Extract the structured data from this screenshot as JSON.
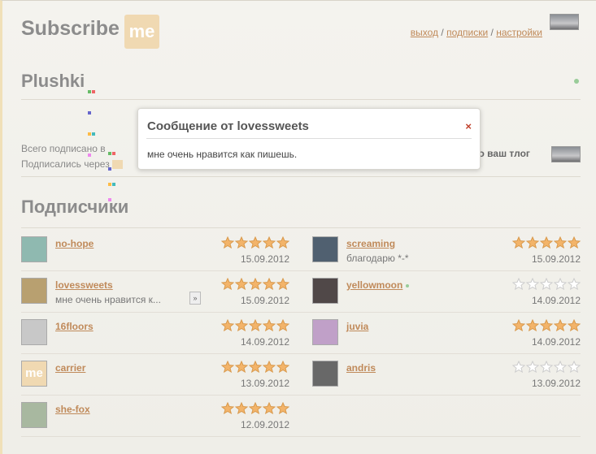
{
  "header": {
    "logo_text": "Subscribe",
    "logo_badge": "me",
    "links": {
      "exit": "выход",
      "subscriptions": "подписки",
      "settings": "настройки"
    },
    "separator": "/"
  },
  "blog": {
    "title": "Plushki",
    "stats_line1": "Всего подписано в",
    "stats_line2": "Подписались через",
    "tlog_text": "его ваш тлог"
  },
  "modal": {
    "title": "Сообщение от lovessweets",
    "close": "×",
    "body": "мне очень нравится как пишешь."
  },
  "subscribers": {
    "title": "Подписчики",
    "left": [
      {
        "name": "no-hope",
        "message": "",
        "date": "15.09.2012",
        "rating": 5,
        "avatar_color": "#8fb9b0"
      },
      {
        "name": "lovessweets",
        "message": "мне очень нравится к...",
        "date": "15.09.2012",
        "rating": 5,
        "avatar_color": "#b8a070",
        "expand": "»"
      },
      {
        "name": "16floors",
        "message": "",
        "date": "14.09.2012",
        "rating": 5,
        "avatar_color": "#c8c8c8"
      },
      {
        "name": "carrier",
        "message": "",
        "date": "13.09.2012",
        "rating": 5,
        "avatar_color": "#f0d9b2",
        "avatar_text": "me"
      },
      {
        "name": "she-fox",
        "message": "",
        "date": "12.09.2012",
        "rating": 5,
        "avatar_color": "#a8b8a0"
      }
    ],
    "right": [
      {
        "name": "screaming",
        "message": "благодарю *-*",
        "date": "15.09.2012",
        "rating": 5,
        "avatar_color": "#506070"
      },
      {
        "name": "yellowmoon",
        "message": "",
        "date": "14.09.2012",
        "rating": 0,
        "avatar_color": "#504848",
        "online": true
      },
      {
        "name": "juvia",
        "message": "",
        "date": "14.09.2012",
        "rating": 5,
        "avatar_color": "#c0a0c8"
      },
      {
        "name": "andris",
        "message": "",
        "date": "13.09.2012",
        "rating": 0,
        "avatar_color": "#686868"
      }
    ]
  },
  "colors": {
    "accent_link": "#c08a5a",
    "star_on": "#f3b46a",
    "star_off": "#ffffff"
  }
}
